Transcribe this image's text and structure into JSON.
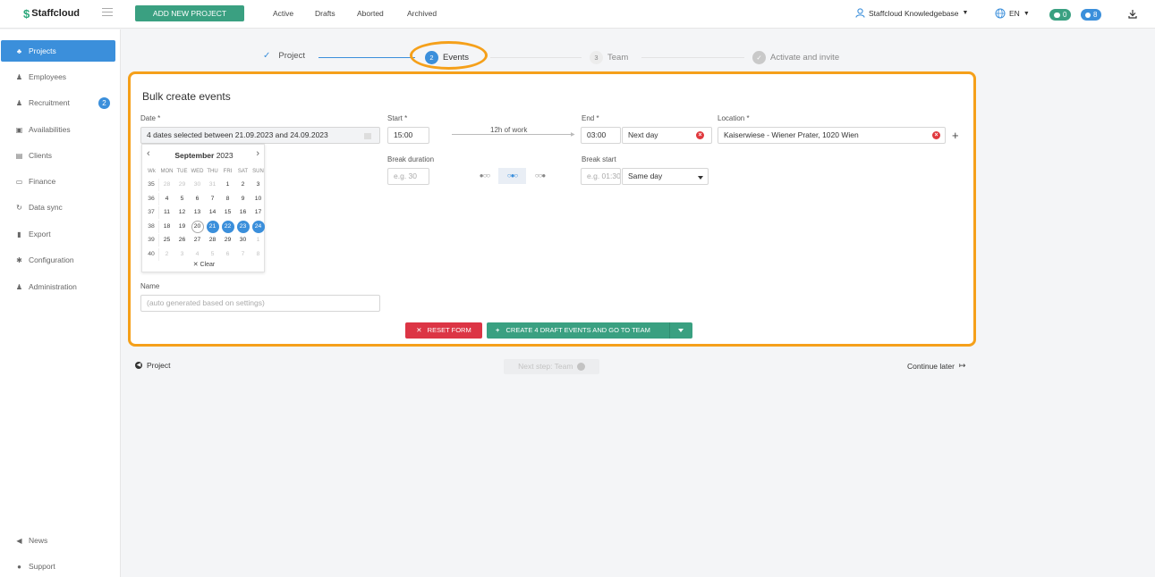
{
  "header": {
    "logo_mark": "$",
    "logo_text": "Staffcloud",
    "new_project_label": "ADD NEW PROJECT",
    "nav": [
      "Active",
      "Drafts",
      "Aborted",
      "Archived"
    ],
    "user_name": "Staffcloud Knowledgebase",
    "language": "EN",
    "chat_count": "0",
    "notification_count": "8"
  },
  "sidebar": {
    "items": [
      {
        "label": "Projects",
        "icon": "sitemap-icon",
        "glyph": "♣",
        "active": true
      },
      {
        "label": "Employees",
        "icon": "users-icon",
        "glyph": "♟",
        "active": false
      },
      {
        "label": "Recruitment",
        "icon": "user-plus-icon",
        "glyph": "♟",
        "active": false,
        "badge": "2"
      },
      {
        "label": "Availabilities",
        "icon": "calendar-check-icon",
        "glyph": "▣",
        "active": false
      },
      {
        "label": "Clients",
        "icon": "building-icon",
        "glyph": "▤",
        "active": false
      },
      {
        "label": "Finance",
        "icon": "money-icon",
        "glyph": "▭",
        "active": false
      },
      {
        "label": "Data sync",
        "icon": "sync-icon",
        "glyph": "↻",
        "active": false
      },
      {
        "label": "Export",
        "icon": "file-icon",
        "glyph": "▮",
        "active": false
      },
      {
        "label": "Configuration",
        "icon": "gear-icon",
        "glyph": "✱",
        "active": false
      },
      {
        "label": "Administration",
        "icon": "user-cog-icon",
        "glyph": "♟",
        "active": false
      }
    ],
    "bottom": [
      {
        "label": "News",
        "icon": "bullhorn-icon",
        "glyph": "◀"
      },
      {
        "label": "Support",
        "icon": "comments-icon",
        "glyph": "●"
      }
    ]
  },
  "stepper": {
    "steps": [
      {
        "label": "Project",
        "num": "✓",
        "state": "done"
      },
      {
        "label": "Events",
        "num": "2",
        "state": "active"
      },
      {
        "label": "Team",
        "num": "3",
        "state": "todo"
      },
      {
        "label": "Activate and invite",
        "num": "✓",
        "state": "todo"
      }
    ]
  },
  "form": {
    "title": "Bulk create events",
    "date_label": "Date *",
    "date_value": "4 dates selected between 21.09.2023 and 24.09.2023",
    "start_label": "Start *",
    "start_value": "15:00",
    "work_hint": "12h of work",
    "end_label": "End *",
    "end_value": "03:00",
    "end_day": "Next day",
    "location_label": "Location *",
    "location_value": "Kaiserwiese - Wiener Prater, 1020 Wien",
    "break_duration_label": "Break duration",
    "break_duration_placeholder": "e.g. 30",
    "break_toggle": [
      "●○○",
      "○●○",
      "○○●"
    ],
    "break_start_label": "Break start",
    "break_start_placeholder": "e.g. 01:30",
    "break_start_day": "Same day",
    "name_label": "Name",
    "name_placeholder": "(auto generated based on settings)",
    "reset_label": "RESET FORM",
    "create_label": "CREATE 4 DRAFT EVENTS AND GO TO TEAM"
  },
  "calendar": {
    "month": "September",
    "year": "2023",
    "headers": [
      "Wk",
      "MON",
      "TUE",
      "WED",
      "THU",
      "FRI",
      "SAT",
      "SUN"
    ],
    "weeks": [
      [
        "35",
        "28",
        "29",
        "30",
        "31",
        "1",
        "2",
        "3"
      ],
      [
        "36",
        "4",
        "5",
        "6",
        "7",
        "8",
        "9",
        "10"
      ],
      [
        "37",
        "11",
        "12",
        "13",
        "14",
        "15",
        "16",
        "17"
      ],
      [
        "38",
        "18",
        "19",
        "20",
        "21",
        "22",
        "23",
        "24"
      ],
      [
        "39",
        "25",
        "26",
        "27",
        "28",
        "29",
        "30",
        "1"
      ],
      [
        "40",
        "2",
        "3",
        "4",
        "5",
        "6",
        "7",
        "8"
      ]
    ],
    "clear_label": "✕ Clear"
  },
  "footer": {
    "back_label": "Project",
    "next_label": "Next step: Team",
    "later_label": "Continue later"
  },
  "colors": {
    "accent_green": "#3aa081",
    "accent_blue": "#3b8fdb",
    "highlight_orange": "#f5a01a",
    "danger_red": "#dc3545"
  }
}
